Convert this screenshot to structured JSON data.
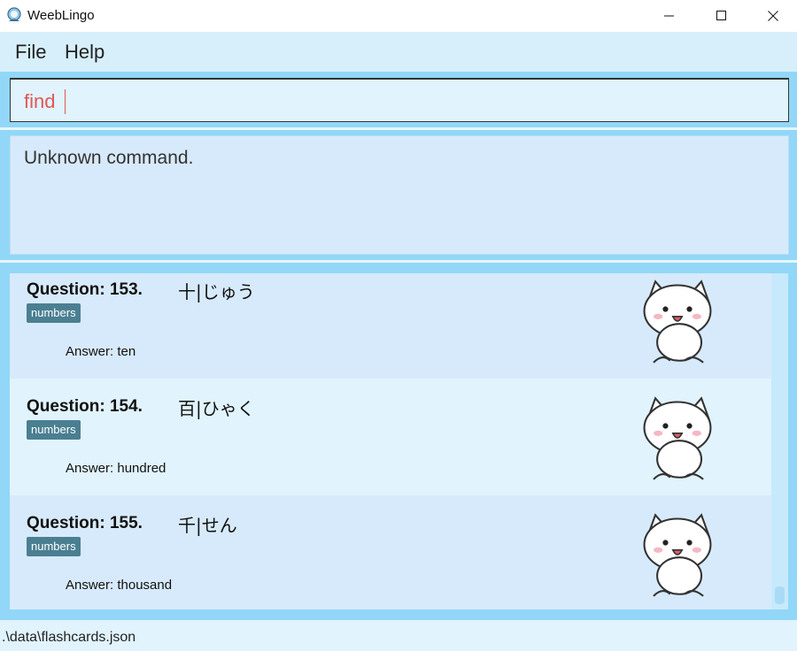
{
  "window": {
    "title": "WeebLingo"
  },
  "menu": {
    "items": [
      "File",
      "Help"
    ]
  },
  "command": {
    "value": "find"
  },
  "result": {
    "text": "Unknown command."
  },
  "flashcards": [
    {
      "question_label": "Question: 153.",
      "question": "十|じゅう",
      "tag": "numbers",
      "answer": "Answer: ten"
    },
    {
      "question_label": "Question: 154.",
      "question": "百|ひゃく",
      "tag": "numbers",
      "answer": "Answer: hundred"
    },
    {
      "question_label": "Question: 155.",
      "question": "千|せん",
      "tag": "numbers",
      "answer": "Answer: thousand"
    }
  ],
  "status": {
    "path": ".\\data\\flashcards.json"
  },
  "icons": {
    "app": "app-icon",
    "card_image": "cat-icon",
    "minimize": "minimize-icon",
    "maximize": "maximize-icon",
    "close": "close-icon"
  },
  "colors": {
    "accent": "#92d7f8",
    "tag": "#4a7f91",
    "command_text": "#e05757"
  }
}
